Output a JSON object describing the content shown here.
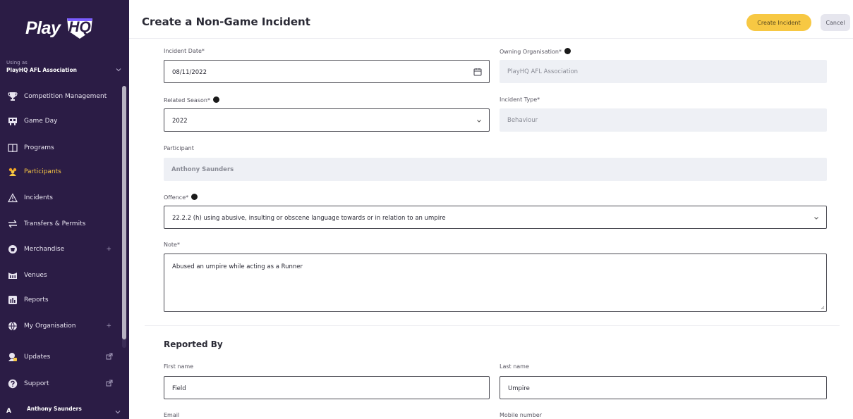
{
  "app": {
    "brand_play": "Play",
    "brand_hq": "HQ"
  },
  "org": {
    "label": "Using as",
    "name": "PlayHQ AFL Association"
  },
  "sidebar": {
    "items": [
      {
        "label": "Competition Management",
        "icon": "trophy-icon"
      },
      {
        "label": "Game Day",
        "icon": "scoreboard-icon"
      },
      {
        "label": "Programs",
        "icon": "book-icon"
      },
      {
        "label": "Participants",
        "icon": "participants-icon"
      },
      {
        "label": "Incidents",
        "icon": "warning-icon"
      },
      {
        "label": "Transfers & Permits",
        "icon": "transfer-icon"
      },
      {
        "label": "Merchandise",
        "icon": "merchandise-icon",
        "expand": "+"
      },
      {
        "label": "Venues",
        "icon": "venue-icon"
      },
      {
        "label": "Reports",
        "icon": "report-icon"
      },
      {
        "label": "My Organisation",
        "icon": "globe-icon",
        "expand": "+"
      },
      {
        "label": "Updates",
        "icon": "updates-icon"
      },
      {
        "label": "Support",
        "icon": "help-icon"
      }
    ],
    "active_item": "Participants",
    "user": {
      "initial": "A",
      "name": "Anthony Saunders"
    }
  },
  "header": {
    "title": "Create a Non-Game Incident",
    "create_label": "Create Incident",
    "cancel_label": "Cancel"
  },
  "form": {
    "incident_date": {
      "label": "Incident Date*",
      "value": "08/11/2022"
    },
    "owning_org": {
      "label": "Owning Organisation*",
      "value": "PlayHQ AFL Association"
    },
    "related_season": {
      "label": "Related Season*",
      "value": "2022"
    },
    "incident_type": {
      "label": "Incident Type*",
      "value": "Behaviour"
    },
    "participant": {
      "label": "Participant",
      "value": "Anthony Saunders"
    },
    "offence": {
      "label": "Offence*",
      "value": "22.2.2 (h) using abusive, insulting or obscene language towards or in relation to an umpire"
    },
    "note": {
      "label": "Note*",
      "value": "Abused an umpire while acting as a Runner"
    }
  },
  "reported_by": {
    "title": "Reported By",
    "first_name": {
      "label": "First name",
      "value": "Field"
    },
    "last_name": {
      "label": "Last name",
      "value": "Umpire"
    },
    "email": {
      "label": "Email"
    },
    "mobile": {
      "label": "Mobile number"
    }
  },
  "colors": {
    "sidebar_bg": "#2b1c45",
    "accent_yellow": "#f7c843",
    "active_nav": "#f5c344",
    "disabled_field": "#eef0f5"
  }
}
